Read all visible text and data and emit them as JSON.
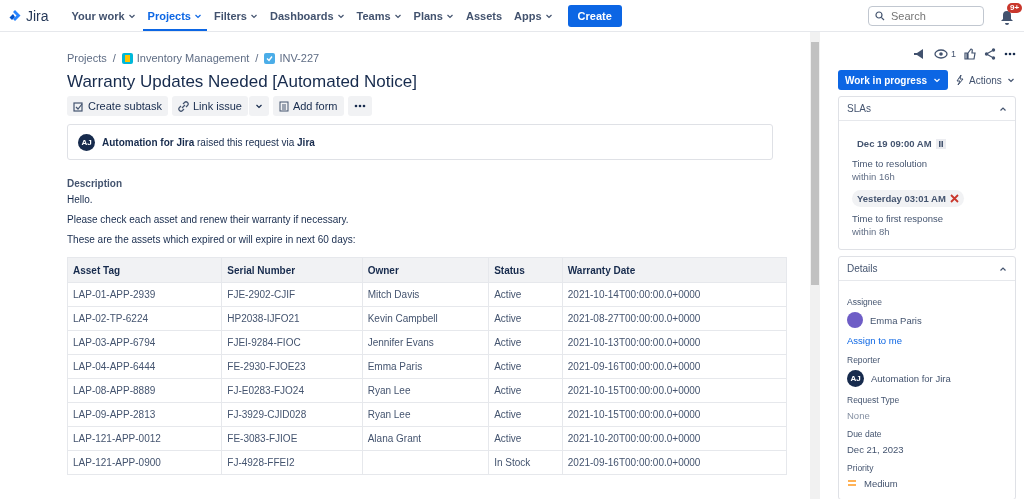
{
  "nav": {
    "logo": "Jira",
    "items": [
      {
        "label": "Your work",
        "selected": false,
        "has_menu": true
      },
      {
        "label": "Projects",
        "selected": true,
        "has_menu": true
      },
      {
        "label": "Filters",
        "selected": false,
        "has_menu": true
      },
      {
        "label": "Dashboards",
        "selected": false,
        "has_menu": true
      },
      {
        "label": "Teams",
        "selected": false,
        "has_menu": true
      },
      {
        "label": "Plans",
        "selected": false,
        "has_menu": true
      },
      {
        "label": "Assets",
        "selected": false,
        "has_menu": false
      },
      {
        "label": "Apps",
        "selected": false,
        "has_menu": true
      }
    ],
    "create": "Create",
    "search": {
      "placeholder": "Search"
    },
    "notification_badge": "9+"
  },
  "breadcrumbs": {
    "separator": "/",
    "items": [
      "Projects",
      "Inventory Management",
      "INV-227"
    ]
  },
  "title": "Warranty Updates Needed [Automated Notice]",
  "toolbar": [
    "Create subtask",
    "Link issue",
    "Add form"
  ],
  "request": {
    "avatar": "AJ",
    "text": "**Automation for Jira** raised this request via **Jira**"
  },
  "description": {
    "heading": "Description",
    "paragraphs": [
      "Hello.",
      "Please check each asset and renew their warranty if necessary.",
      "These are the assets which expired or will expire in next 60 days:"
    ]
  },
  "table": {
    "columns": [
      "Asset Tag",
      "Serial Number",
      "Owner",
      "Status",
      "Warranty Date"
    ],
    "rows": [
      [
        "LAP-01-APP-2939",
        "FJE-2902-CJIF",
        "Mitch Davis",
        "Active",
        "2021-10-14T00:00:00.0+0000"
      ],
      [
        "LAP-02-TP-6224",
        "HP2038-IJFO21",
        "Kevin Campbell",
        "Active",
        "2021-08-27T00:00:00.0+0000"
      ],
      [
        "LAP-03-APP-6794",
        "FJEI-9284-FIOC",
        "Jennifer Evans",
        "Active",
        "2021-10-13T00:00:00.0+0000"
      ],
      [
        "LAP-04-APP-6444",
        "FE-2930-FJOE23",
        "Emma Paris",
        "Active",
        "2021-09-16T00:00:00.0+0000"
      ],
      [
        "LAP-08-APP-8889",
        "FJ-E0283-FJO24",
        "Ryan Lee",
        "Active",
        "2021-10-15T00:00:00.0+0000"
      ],
      [
        "LAP-09-APP-2813",
        "FJ-3929-CJID028",
        "Ryan Lee",
        "Active",
        "2021-10-15T00:00:00.0+0000"
      ],
      [
        "LAP-121-APP-0012",
        "FE-3083-FJIOE",
        "Alana Grant",
        "Active",
        "2021-10-20T00:00:00.0+0000"
      ],
      [
        "LAP-121-APP-0900",
        "FJ-4928-FFEI2",
        "",
        "In Stock",
        "2021-09-16T00:00:00.0+0000"
      ]
    ]
  },
  "side": {
    "watchers": "1",
    "status": "Work in progress",
    "actions": "Actions",
    "slas": {
      "title": "SLAs",
      "expanded": true,
      "items": [
        {
          "time": "Dec 19 09:00 AM",
          "kind": "paused",
          "name": "Time to resolution",
          "goal": "within 16h"
        },
        {
          "time": "Yesterday 03:01 AM",
          "kind": "breached",
          "name": "Time to first response",
          "goal": "within 8h"
        }
      ]
    },
    "details": {
      "title": "Details",
      "expanded": true,
      "fields": [
        {
          "label": "Assignee",
          "kind": "user",
          "value": "Emma Paris",
          "avatar_photo": true,
          "link": "Assign to me"
        },
        {
          "label": "Reporter",
          "kind": "user",
          "value": "Automation for Jira",
          "avatar_photo": false,
          "initials": "AJ"
        },
        {
          "label": "Request Type",
          "kind": "empty",
          "value": "None"
        },
        {
          "label": "Due date",
          "kind": "text",
          "value": "Dec 21, 2023"
        },
        {
          "label": "Priority",
          "kind": "priority",
          "value": "Medium"
        }
      ]
    }
  }
}
